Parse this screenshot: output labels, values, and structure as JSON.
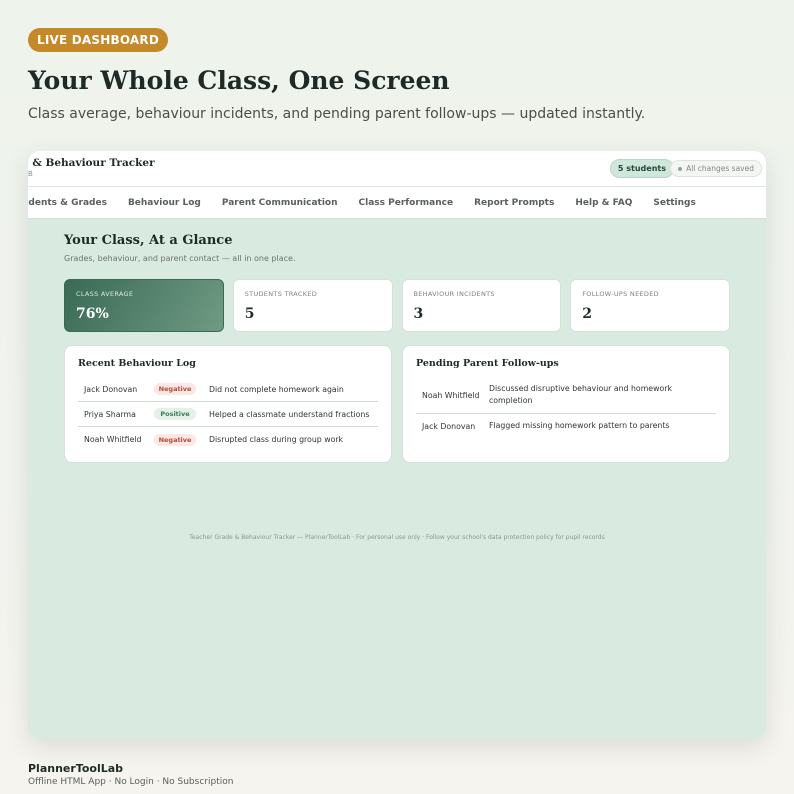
{
  "hero": {
    "badge": "LIVE DASHBOARD",
    "title": "Your Whole Class, One Screen",
    "subtitle": "Class average, behaviour incidents, and pending parent follow-ups — updated instantly."
  },
  "app": {
    "title": "e & Behaviour Tracker",
    "subtitle": "B",
    "students_pill": "5 students",
    "saved_pill": "All changes saved",
    "nav": [
      "udents & Grades",
      "Behaviour Log",
      "Parent Communication",
      "Class Performance",
      "Report Prompts",
      "Help & FAQ",
      "Settings"
    ],
    "section_title": "Your Class, At a Glance",
    "section_sub": "Grades, behaviour, and parent contact — all in one place.",
    "stats": [
      {
        "label": "CLASS AVERAGE",
        "value": "76%"
      },
      {
        "label": "STUDENTS TRACKED",
        "value": "5"
      },
      {
        "label": "BEHAVIOUR INCIDENTS",
        "value": "3"
      },
      {
        "label": "FOLLOW-UPS NEEDED",
        "value": "2"
      }
    ],
    "behaviour_log": {
      "title": "Recent Behaviour Log",
      "rows": [
        {
          "name": "Jack Donovan",
          "tag": "Negative",
          "note": "Did not complete homework again"
        },
        {
          "name": "Priya Sharma",
          "tag": "Positive",
          "note": "Helped a classmate understand fractions"
        },
        {
          "name": "Noah Whitfield",
          "tag": "Negative",
          "note": "Disrupted class during group work"
        }
      ]
    },
    "follow_ups": {
      "title": "Pending Parent Follow-ups",
      "rows": [
        {
          "name": "Noah Whitfield",
          "note": "Discussed disruptive behaviour and homework completion"
        },
        {
          "name": "Jack Donovan",
          "note": "Flagged missing homework pattern to parents"
        }
      ]
    },
    "footer": "Teacher Grade & Behaviour Tracker — PlannerToolLab · For personal use only · Follow your school's data protection policy for pupil records"
  },
  "brand": {
    "name": "PlannerToolLab",
    "tagline": "Offline HTML App  ·  No Login  ·  No Subscription"
  },
  "colors": {
    "accent": "#c5892a",
    "app_bg": "#d9ebe1",
    "highlight": "#3a6a55"
  }
}
